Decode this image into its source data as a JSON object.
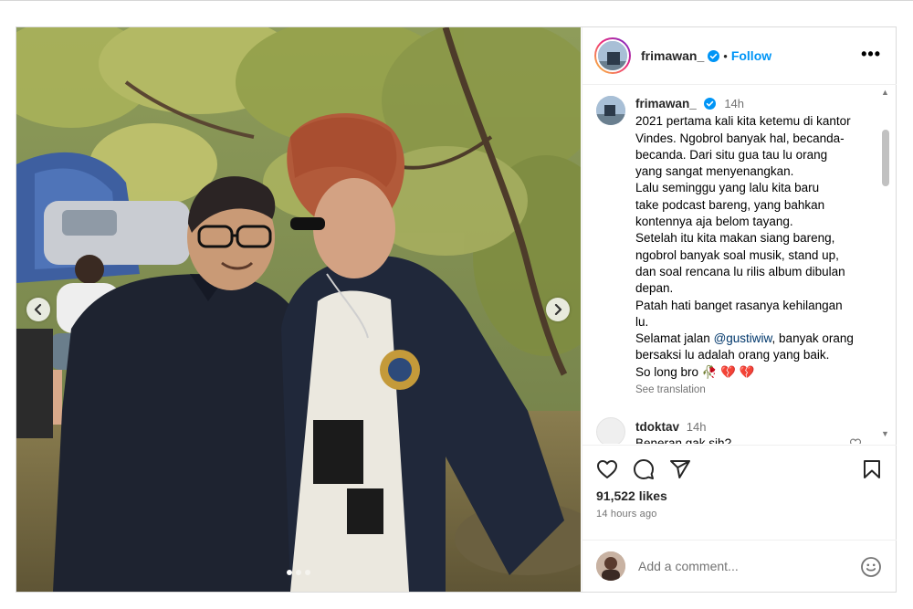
{
  "post": {
    "author": "frimawan_",
    "follow_label": "Follow",
    "separator": "•",
    "more_label": "•••",
    "caption": {
      "time": "14h",
      "lines": [
        "2021 pertama kali kita ketemu di kantor",
        "Vindes. Ngobrol banyak hal, becanda-",
        "becanda. Dari situ gua tau lu orang",
        "yang sangat menyenangkan.",
        "Lalu seminggu yang lalu kita baru",
        "take podcast bareng, yang bahkan",
        "kontennya aja belom tayang.",
        "Setelah itu kita makan siang bareng,",
        "ngobrol banyak soal musik, stand up,",
        "dan soal rencana lu rilis album dibulan",
        "depan.",
        "Patah hati banget rasanya kehilangan",
        "lu."
      ],
      "mention_prefix": "Selamat jalan ",
      "mention": "@gustiwiw",
      "mention_suffix": ", banyak orang",
      "lines_after": [
        "bersaksi lu adalah orang yang baik.",
        "So long bro 🥀 💔 💔"
      ],
      "see_translation": "See translation"
    },
    "comment": {
      "user": "tdoktav",
      "time": "14h",
      "text": "Beneran gak sih?"
    },
    "likes": "91,522 likes",
    "posted_ago": "14 hours ago",
    "add_comment_placeholder": "Add a comment...",
    "carousel": {
      "slides": 3,
      "active_index": 0
    },
    "colors": {
      "link": "#0095f6",
      "mention": "#00376b",
      "verified": "#0095f6"
    },
    "icons": [
      "verified-icon",
      "heart-icon",
      "comment-icon",
      "share-icon",
      "bookmark-icon",
      "emoji-icon",
      "chevron-left-icon",
      "chevron-right-icon"
    ]
  }
}
